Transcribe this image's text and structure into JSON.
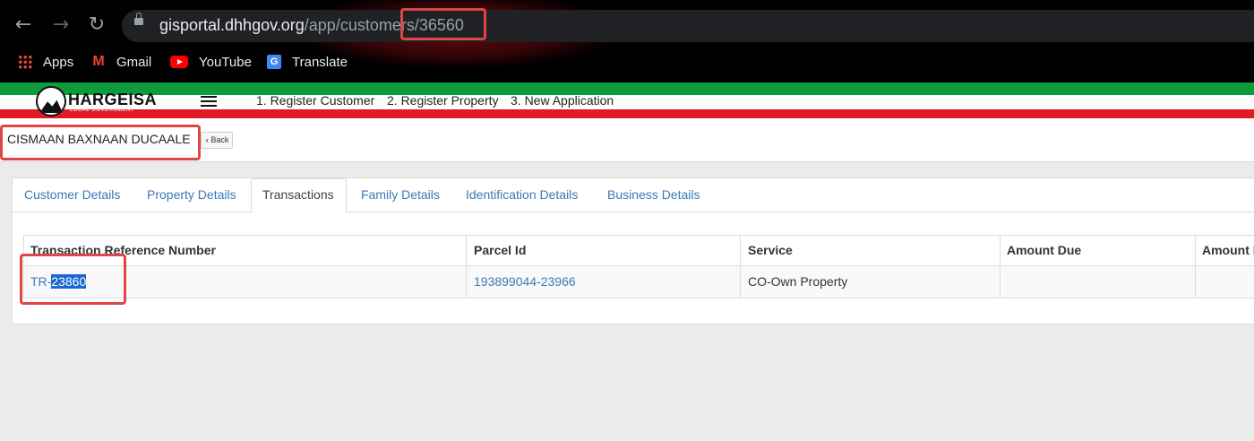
{
  "browser": {
    "url_host": "gisportal.dhhgov.org",
    "url_path": "/app/customers/36560",
    "bookmarks": [
      {
        "label": "Apps",
        "icon": "apps-grid-icon"
      },
      {
        "label": "Gmail",
        "icon": "gmail-icon"
      },
      {
        "label": "YouTube",
        "icon": "youtube-icon"
      },
      {
        "label": "Translate",
        "icon": "google-translate-icon"
      }
    ]
  },
  "app": {
    "logo_text": "HARGEISA",
    "logo_subtext": "LOCAL GOVERNMENT",
    "nav": [
      "1. Register Customer",
      "2. Register Property",
      "3. New Application"
    ]
  },
  "customer": {
    "name": "CISMAAN BAXNAAN DUCAALE",
    "back_label": "Back"
  },
  "tabs": [
    {
      "label": "Customer Details",
      "active": false
    },
    {
      "label": "Property Details",
      "active": false
    },
    {
      "label": "Transactions",
      "active": true
    },
    {
      "label": "Family Details",
      "active": false
    },
    {
      "label": "Identification Details",
      "active": false
    },
    {
      "label": "Business Details",
      "active": false
    }
  ],
  "transactions": {
    "columns": [
      "Transaction Reference Number",
      "Parcel Id",
      "Service",
      "Amount Due",
      "Amount P"
    ],
    "rows": [
      {
        "ref_prefix": "TR-",
        "ref_selected": "23860",
        "parcel_id": "193899044-23966",
        "service": "CO-Own Property",
        "amount_due": "",
        "amount_paid": ""
      }
    ]
  },
  "colors": {
    "highlight_box": "#e04646",
    "link": "#3a7ab8",
    "flag_green": "#0e9b3d",
    "flag_red": "#e01b24"
  }
}
